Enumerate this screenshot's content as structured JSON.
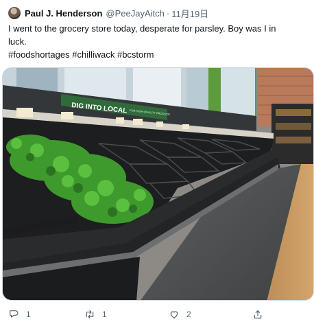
{
  "tweet": {
    "author_name": "Paul J. Henderson",
    "handle": "@PeeJayAitch",
    "separator": "·",
    "date": "11月19日",
    "text_line1": "I went to the grocery store today, desperate for parsley. Boy was I in",
    "text_line2": "luck.",
    "hashtags": "#foodshortages #chilliwack #bcstorm",
    "media": {
      "sign_text": "DIG INTO LOCAL",
      "sign_subtext": "FOR HIGH-QUALITY PRODUCE",
      "sign_color": "#2f6b3a",
      "parsley_color": "#3e9a2c"
    }
  },
  "actions": {
    "reply_icon": "reply-icon",
    "reply_count": "1",
    "retweet_icon": "retweet-icon",
    "retweet_count": "1",
    "like_icon": "heart-icon",
    "like_count": "2",
    "share_icon": "share-icon"
  }
}
